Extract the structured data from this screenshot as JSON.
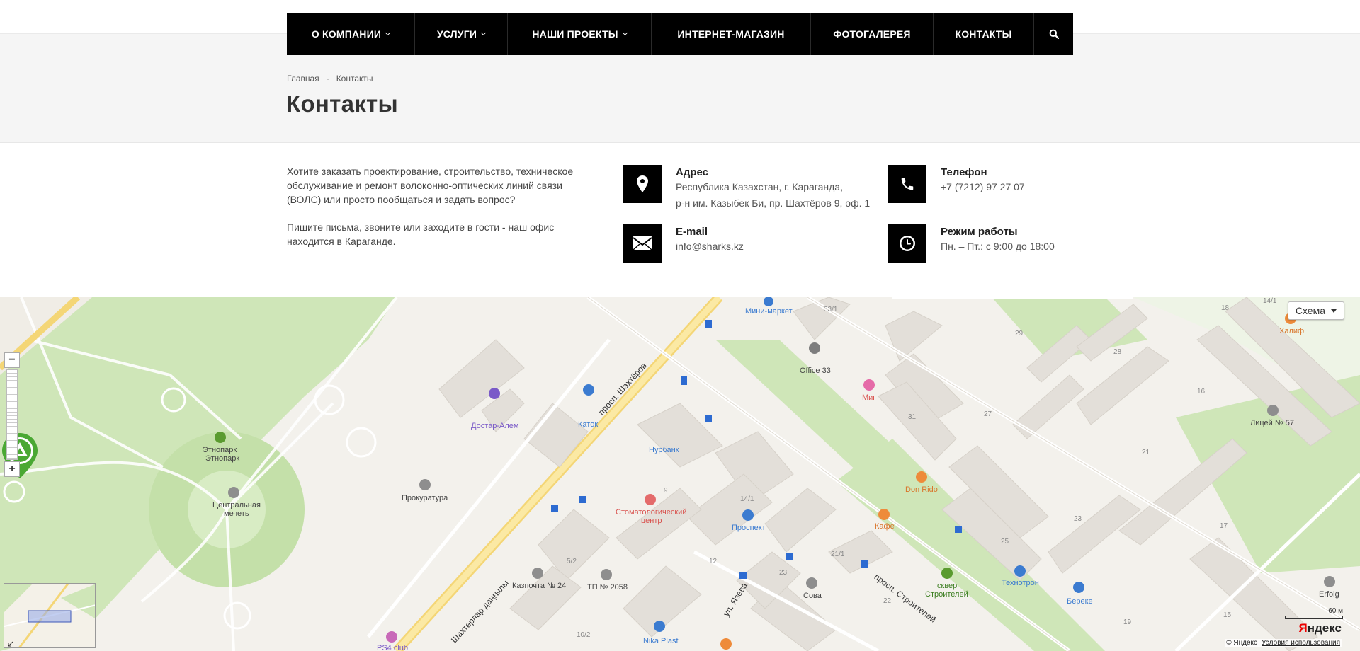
{
  "nav": {
    "items": [
      {
        "label": "О КОМПАНИИ",
        "dropdown": true
      },
      {
        "label": "УСЛУГИ",
        "dropdown": true
      },
      {
        "label": "НАШИ ПРОЕКТЫ",
        "dropdown": true
      },
      {
        "label": "ИНТЕРНЕТ-МАГАЗИН",
        "dropdown": false
      },
      {
        "label": "ФОТОГАЛЕРЕЯ",
        "dropdown": false
      },
      {
        "label": "КОНТАКТЫ",
        "dropdown": false
      }
    ],
    "search_icon": "search-icon"
  },
  "breadcrumb": {
    "home": "Главная",
    "separator": "-",
    "current": "Контакты"
  },
  "page": {
    "title": "Контакты"
  },
  "intro": {
    "p1": "Хотите заказать проектирование, строительство, техническое обслуживание и ремонт волоконно-оптических линий связи (ВОЛС) или просто пообщаться и задать вопрос?",
    "p2": "Пишите письма, звоните или заходите в гости - наш офис находится в Караганде."
  },
  "contacts": {
    "address": {
      "title": "Адрес",
      "line1": "Республика Казахстан, г. Караганда,",
      "line2": "р-н им. Казыбек Би, пр. Шахтёров 9, оф. 1",
      "icon": "map-pin-icon"
    },
    "phone": {
      "title": "Телефон",
      "value": "+7 (7212) 97 27 07",
      "icon": "phone-icon"
    },
    "email": {
      "title": "E-mail",
      "value": "info@sharks.kz",
      "icon": "envelope-icon"
    },
    "hours": {
      "title": "Режим работы",
      "value": "Пн. – Пт.: с 9:00 до 18:00",
      "icon": "clock-icon"
    }
  },
  "map": {
    "layer_button": "Схема",
    "zoom_in": "+",
    "zoom_out": "−",
    "scale": "60 м",
    "logo": "Яндекс",
    "copyright": "© Яндекс",
    "terms": "Условия использования",
    "labels": {
      "minimarket": "Мини-маркет",
      "office33": "Office 33",
      "mig": "Миг",
      "dostar": "Достар-Алем",
      "katok": "Каток",
      "bank": "Нурбанк",
      "etnopark1": "Этнопарк",
      "etnopark2": "Этнопарк",
      "mosque1": "Центральная",
      "mosque2": "мечеть",
      "prokuratura": "Прокуратура",
      "dental1": "Стоматологический",
      "dental2": "центр",
      "prospekt": "Проспект",
      "donrido": "Don Rido",
      "kafe": "Кафе",
      "kazpochta": "Казпочта № 24",
      "tp": "ТП № 2058",
      "nikaplast": "Nika Plast",
      "sova": "Сова",
      "skver1": "сквер",
      "skver2": "Строителей",
      "tekhnotron": "Технотрон",
      "bereke": "Береке",
      "erfolg": "Erfolg",
      "lyceum": "Лицей № 57",
      "khalif": "Халиф",
      "ps4": "PS4 club",
      "street_shakhterov": "просп. Шахтёров",
      "street_kz": "Шахтерлар даңғылы",
      "street_stroiteley": "просп. Строителей",
      "street_yazeva": "ул. Язева",
      "n33_1": "33/1",
      "n18": "18",
      "n14_1": "14/1",
      "n29": "29",
      "n28": "28",
      "n16": "16",
      "n27": "27",
      "n31": "31",
      "n21": "21",
      "n23": "23",
      "n25": "25",
      "n17": "17",
      "n9": "9",
      "n14_1b": "14/1",
      "n5_2": "5/2",
      "n12": "12",
      "n21_1": "21/1",
      "n23b": "23",
      "n22": "22",
      "n19": "19",
      "n15": "15",
      "n10_2": "10/2"
    }
  }
}
